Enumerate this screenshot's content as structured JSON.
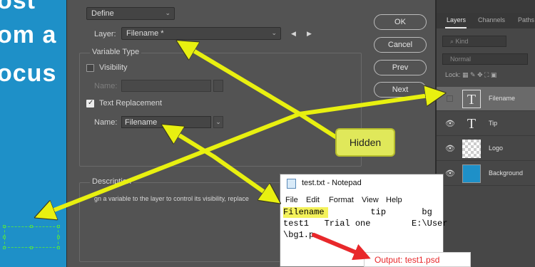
{
  "canvas": {
    "lines": [
      "ost",
      "om a",
      "ocus"
    ],
    "colors": {
      "poster": "#1e90c8",
      "selection": "#4fdc4f"
    }
  },
  "dialog": {
    "mode_select": "Define",
    "layer_label": "Layer:",
    "layer_value": "Filename *",
    "nav_prev_icon": "◀",
    "nav_next_icon": "▶",
    "variable_type_legend": "Variable Type",
    "visibility": {
      "label": "Visibility",
      "checked": false,
      "name_label": "Name:",
      "name_value": ""
    },
    "text_replacement": {
      "label": "Text Replacement",
      "checked": true,
      "name_label": "Name:",
      "name_value": "Filename"
    },
    "description_legend": "Description",
    "description_text": "gn a variable to the layer to control its visibility, replace",
    "buttons": {
      "ok": "OK",
      "cancel": "Cancel",
      "prev": "Prev",
      "next": "Next"
    }
  },
  "layers_panel": {
    "tabs": [
      "Layers",
      "Channels",
      "Paths"
    ],
    "kind_label": "Kind",
    "blend_mode": "Normal",
    "lock_label": "Lock:",
    "layers": [
      {
        "name": "Filename",
        "thumb": "T",
        "visible": false,
        "selected": true
      },
      {
        "name": "Tip",
        "thumb": "T",
        "visible": true,
        "selected": false
      },
      {
        "name": "Logo",
        "thumb": "checker",
        "visible": true,
        "selected": false
      },
      {
        "name": "Background",
        "thumb": "blue",
        "visible": true,
        "selected": false
      }
    ]
  },
  "notepad": {
    "title": "test.txt - Notepad",
    "menu": [
      "File",
      "Edit",
      "Format",
      "View",
      "Help"
    ],
    "line1": "Filename         tip       bg",
    "line2": "test1   Trial one        E:\\User",
    "line3": "\\bg1.p"
  },
  "annotations": {
    "hidden_callout": "Hidden",
    "output_label": "Output: test1.psd",
    "arrow_color": "#e8f010",
    "red_arrow_color": "#e8282b"
  }
}
